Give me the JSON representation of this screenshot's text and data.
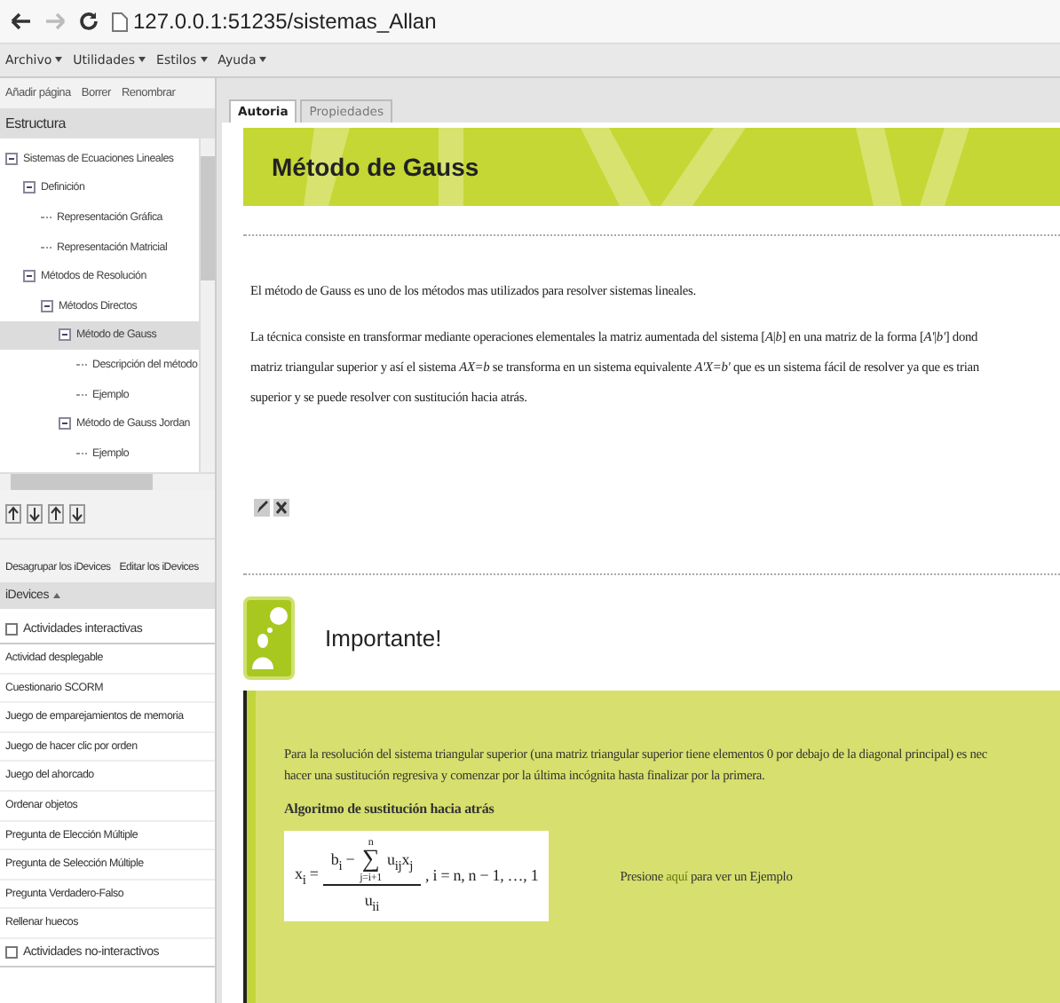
{
  "browser": {
    "url": "127.0.0.1:51235/sistemas_Allan"
  },
  "menu": [
    "Archivo",
    "Utilidades",
    "Estilos",
    "Ayuda"
  ],
  "sidebar": {
    "toolbar": [
      "Añadir página",
      "Borrer",
      "Renombrar"
    ],
    "structure_title": "Estructura",
    "tree": [
      {
        "label": "Sistemas de Ecuaciones Lineales",
        "expanded": true,
        "selected": false,
        "children": [
          {
            "label": "Definición",
            "expanded": true,
            "selected": false,
            "children": [
              {
                "label": "Representación Gráfica",
                "selected": false
              },
              {
                "label": "Representación Matricial",
                "selected": false
              }
            ]
          },
          {
            "label": "Métodos de Resolución",
            "expanded": true,
            "selected": false,
            "children": [
              {
                "label": "Métodos Directos",
                "expanded": true,
                "selected": false,
                "children": [
                  {
                    "label": "Método de Gauss",
                    "expanded": true,
                    "selected": true,
                    "children": [
                      {
                        "label": "Descripción del método",
                        "selected": false
                      },
                      {
                        "label": "Ejemplo",
                        "selected": false
                      }
                    ]
                  },
                  {
                    "label": "Método de Gauss Jordan",
                    "expanded": true,
                    "selected": false,
                    "children": [
                      {
                        "label": "Ejemplo",
                        "selected": false
                      }
                    ]
                  }
                ]
              }
            ]
          }
        ]
      }
    ],
    "idevice_actions": [
      "Desagrupar los iDevices",
      "Editar los iDevices"
    ],
    "idevices_title": "iDevices",
    "idevice_groups": [
      {
        "label": "Actividades interactivas",
        "items": [
          "Actividad desplegable",
          "Cuestionario SCORM",
          "Juego de emparejamientos de memoria",
          "Juego de hacer clic por orden",
          "Juego del ahorcado",
          "Ordenar objetos",
          "Pregunta de Elección Múltiple",
          "Pregunta de Selección Múltiple",
          "Pregunta Verdadero-Falso",
          "Rellenar huecos"
        ]
      },
      {
        "label": "Actividades no-interactivos"
      }
    ]
  },
  "tabs": [
    {
      "label": "Autoria",
      "selected": true
    },
    {
      "label": "Propiedades",
      "selected": false
    }
  ],
  "page": {
    "title": "Método de Gauss",
    "paragraphs": [
      [
        "El método de Gauss es uno de los métodos mas utilizados para resolver sistemas lineales."
      ],
      [
        "La técnica consiste en transformar mediante operaciones elementales la matriz aumentada del sistema [*A*|*b*] en una matriz de la forma [*A'*|*b'*] dond",
        "matriz triangular superior y así el sistema *AX=b* se transforma en un sistema equivalente *A'X=b'* que es un sistema fácil de resolver ya que es trian",
        "superior y se puede resolver con sustitución hacia atrás."
      ]
    ],
    "box": {
      "title": "Importante!",
      "lines": [
        "Para la resolución del sistema triangular superior (una matriz triangular superior tiene elementos 0 por debajo de la diagonal principal) es nec",
        "hacer una sustitución regresiva y comenzar por la última incógnita hasta finalizar por la primera."
      ],
      "heading": "Algoritmo de sustitución hacia atrás",
      "formula": {
        "lhs": "x$_{i}$ =",
        "numerator": "b$_{i}$ −",
        "sum_top": "n",
        "sum_sign": "∑",
        "sum_bottom": "j=i+1",
        "term": "u$_{ij}$x$_{j}$",
        "denominator": "u$_{ii}$",
        "range": ",   i = n, n − 1, …, 1"
      },
      "example": {
        "before": "Presione ",
        "link": "aquí",
        "after": " para ver un Ejemplo"
      }
    }
  }
}
